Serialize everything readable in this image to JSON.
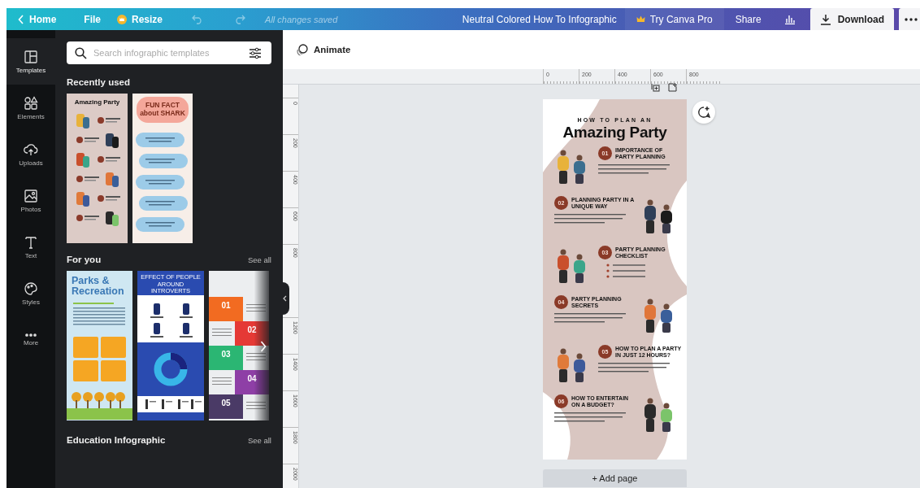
{
  "topbar": {
    "home": "Home",
    "file": "File",
    "resize": "Resize",
    "undo_disabled": true,
    "redo_disabled": true,
    "save_status": "All changes saved",
    "title": "Neutral Colored How To Infographic",
    "pro": "Try Canva Pro",
    "share": "Share",
    "download": "Download"
  },
  "rail": [
    {
      "label": "Templates",
      "selected": true
    },
    {
      "label": "Elements",
      "selected": false
    },
    {
      "label": "Uploads",
      "selected": false
    },
    {
      "label": "Photos",
      "selected": false
    },
    {
      "label": "Text",
      "selected": false
    },
    {
      "label": "Styles",
      "selected": false
    },
    {
      "label": "More",
      "selected": false
    }
  ],
  "panel": {
    "search": {
      "placeholder": "Search infographic templates"
    },
    "sections": [
      {
        "title": "Recently used",
        "thumbnails": [
          {
            "kind": "party",
            "title": "Amazing Party"
          },
          {
            "kind": "shark",
            "title": "FUN FACT about SHARK"
          }
        ]
      },
      {
        "title": "For you",
        "see_all": "See all",
        "thumbnails": [
          {
            "kind": "parks",
            "title": "Parks & Recreation"
          },
          {
            "kind": "introverts",
            "title": "EFFECT OF PEOPLE AROUND INTROVERTS"
          },
          {
            "kind": "habits",
            "numbers": [
              "01",
              "02",
              "03",
              "04",
              "05"
            ]
          }
        ]
      },
      {
        "title": "Education Infographic",
        "see_all": "See all"
      }
    ]
  },
  "toolbar": {
    "animate": "Animate"
  },
  "ruler": {
    "horizontal": [
      "0",
      "200",
      "400",
      "600",
      "800"
    ],
    "vertical_above": [
      "0",
      "200",
      "400",
      "600",
      "800"
    ],
    "vertical_below": [
      "1200",
      "1400",
      "1600",
      "1800",
      "2000"
    ]
  },
  "design": {
    "kicker": "HOW TO PLAN AN",
    "title": "Amazing Party",
    "steps": [
      {
        "number": "01",
        "title": "IMPORTANCE OF PARTY PLANNING",
        "kind": "text"
      },
      {
        "number": "02",
        "title": "PLANNING PARTY IN A UNIQUE WAY",
        "kind": "text"
      },
      {
        "number": "03",
        "title": "PARTY PLANNING CHECKLIST",
        "kind": "checklist"
      },
      {
        "number": "04",
        "title": "PARTY PLANNING SECRETS",
        "kind": "text"
      },
      {
        "number": "05",
        "title": "HOW TO PLAN A PARTY IN JUST 12 HOURS?",
        "kind": "text"
      },
      {
        "number": "06",
        "title": "HOW TO ENTERTAIN ON A BUDGET?",
        "kind": "text"
      }
    ]
  },
  "add_page": "+ Add page"
}
